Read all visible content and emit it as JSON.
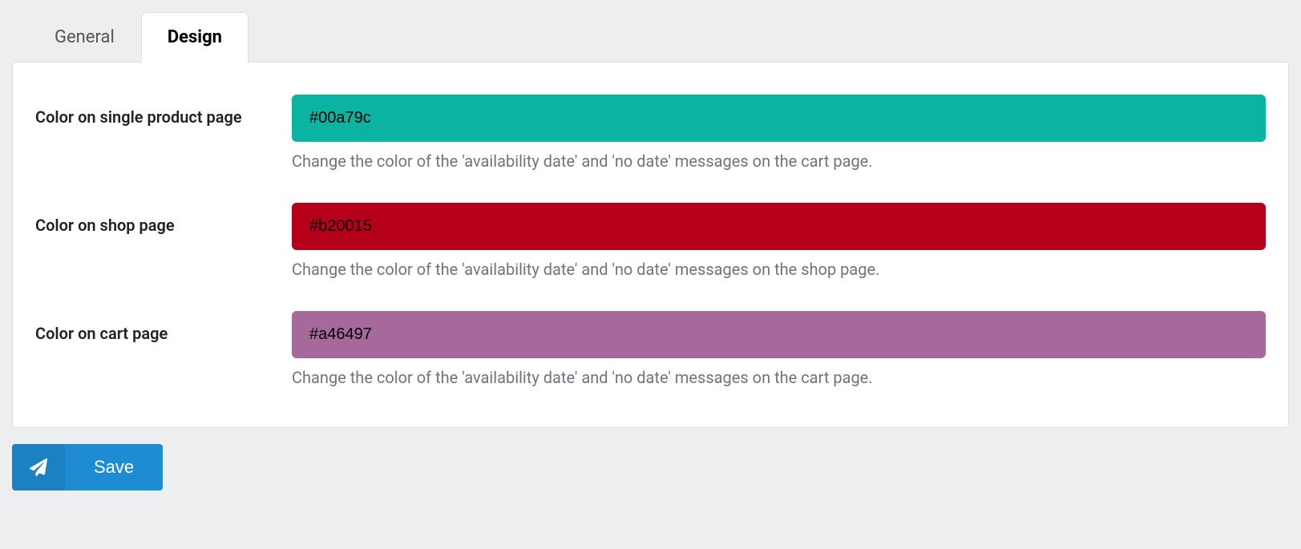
{
  "tabs": {
    "general": "General",
    "design": "Design"
  },
  "fields": {
    "single_product": {
      "label": "Color on single product page",
      "value": "#00a79c",
      "bg": "#0bb3a2",
      "help": "Change the color of the 'availability date' and 'no date' messages on the cart page."
    },
    "shop": {
      "label": "Color on shop page",
      "value": "#b20015",
      "bg": "#b6001a",
      "help": "Change the color of the 'availability date' and 'no date' messages on the shop page."
    },
    "cart": {
      "label": "Color on cart page",
      "value": "#a46497",
      "bg": "#a6699c",
      "help": "Change the color of the 'availability date' and 'no date' messages on the cart page."
    }
  },
  "buttons": {
    "save": "Save"
  }
}
